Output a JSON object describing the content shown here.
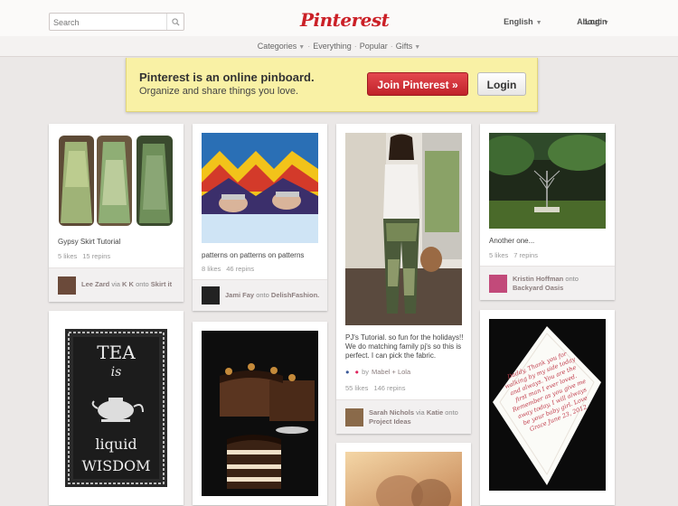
{
  "header": {
    "search_placeholder": "Search",
    "logo": "Pinterest",
    "language": "English",
    "about": "About",
    "login": "Login"
  },
  "subnav": {
    "categories": "Categories",
    "everything": "Everything",
    "popular": "Popular",
    "gifts": "Gifts"
  },
  "banner": {
    "headline": "Pinterest is an online pinboard.",
    "subline": "Organize and share things you love.",
    "join_button": "Join Pinterest »",
    "login_button": "Login"
  },
  "pins": [
    {
      "description": "Gypsy Skirt Tutorial",
      "likes": "5 likes",
      "repins": "15 repins",
      "user": "Lee Zard",
      "via": "via",
      "via_user": "K K",
      "onto": "onto",
      "board": "Skirt it"
    },
    {
      "description": "patterns on patterns on patterns",
      "likes": "8 likes",
      "repins": "46 repins",
      "user": "Jami Fay",
      "onto": "onto",
      "board": "DelishFashion."
    },
    {
      "description": "PJ's Tutorial. so fun for the holidays!! We do matching family pj's so this is perfect. I can pick the fabric.",
      "by": "by",
      "source": "Mabel + Lola",
      "likes": "55 likes",
      "repins": "146 repins",
      "user": "Sarah Nichols",
      "via": "via",
      "via_user": "Katie",
      "onto": "onto",
      "board": "Project Ideas"
    },
    {
      "description": "Another one...",
      "likes": "5 likes",
      "repins": "7 repins",
      "user": "Kristin Hoffman",
      "onto": "onto",
      "board": "Backyard Oasis"
    },
    {
      "poster_lines": [
        "TEA",
        "is",
        "liquid",
        "WISDOM"
      ]
    },
    {},
    {},
    {
      "handkerchief_text": "Daddy, Thank you for walking by my side today and always. You are the first man I ever loved. Remember as you give me away today, I will always be your baby girl. Love Grace June 23, 2012"
    }
  ]
}
